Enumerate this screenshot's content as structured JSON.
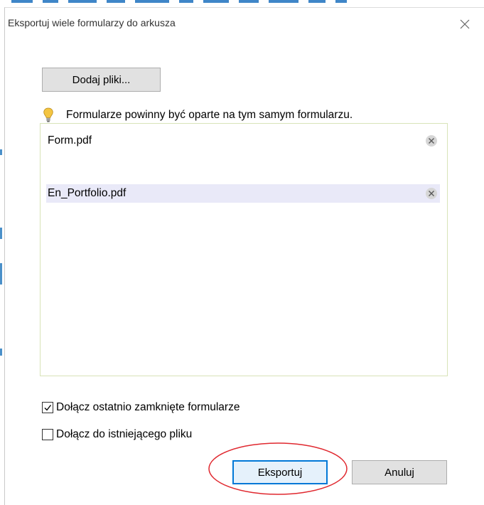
{
  "dialog": {
    "title": "Eksportuj wiele formularzy do arkusza",
    "close_icon": "close-icon"
  },
  "add_button": {
    "label": "Dodaj pliki..."
  },
  "hint": {
    "icon": "lightbulb-icon",
    "text": "Formularze powinny być oparte na tym samym formularzu."
  },
  "files": [
    {
      "name": "Form.pdf",
      "selected": false,
      "remove_icon": "remove-circle-icon"
    },
    {
      "name": "En_Portfolio.pdf",
      "selected": true,
      "remove_icon": "remove-circle-icon"
    }
  ],
  "options": {
    "include_recent": {
      "label": "Dołącz ostatnio zamknięte formularze",
      "checked": true
    },
    "append_existing": {
      "label": "Dołącz do istniejącego pliku",
      "checked": false
    }
  },
  "buttons": {
    "export": "Eksportuj",
    "cancel": "Anuluj"
  },
  "colors": {
    "accent": "#0078d7",
    "highlight_ellipse": "#e0282f",
    "selected_row": "#e9e9f8",
    "button_face": "#e1e1e1"
  }
}
